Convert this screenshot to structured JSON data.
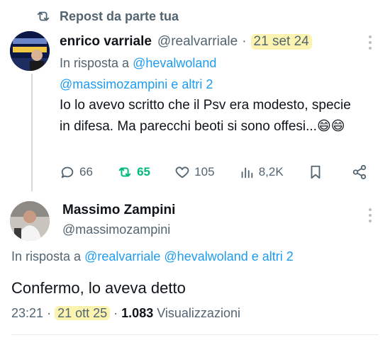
{
  "repost": {
    "icon": "repost-icon",
    "label": "Repost da parte tua"
  },
  "tweet1": {
    "author_name": "enrico varriale",
    "handle": "@realvarriale",
    "separator": "·",
    "date": "21 set 24",
    "reply_prefix": "In risposta a",
    "reply_handle1": "@hevalwoland",
    "reply_handle2": "@massimozampini e altri 2",
    "text": "Io lo avevo scritto che il Psv era modesto, specie in difesa. Ma parecchi beoti si sono offesi...😄😄",
    "actions": {
      "replies": "66",
      "reposts": "65",
      "likes": "105",
      "views": "8,2K"
    }
  },
  "tweet2": {
    "author_name": "Massimo Zampini",
    "handle": "@massimozampini",
    "reply_prefix": "In risposta a",
    "reply_handle1": "@realvarriale",
    "reply_handle2": "@hevalwoland e altri 2",
    "text": "Confermo, lo aveva detto",
    "time": "23:21",
    "separator": "·",
    "date": "21 ott 25",
    "views_count": "1.083",
    "views_label": "Visualizzazioni"
  },
  "colors": {
    "accent": "#1d9bf0",
    "repost_active": "#00ba7c",
    "muted": "#536471",
    "highlight": "#fbf3b0"
  }
}
